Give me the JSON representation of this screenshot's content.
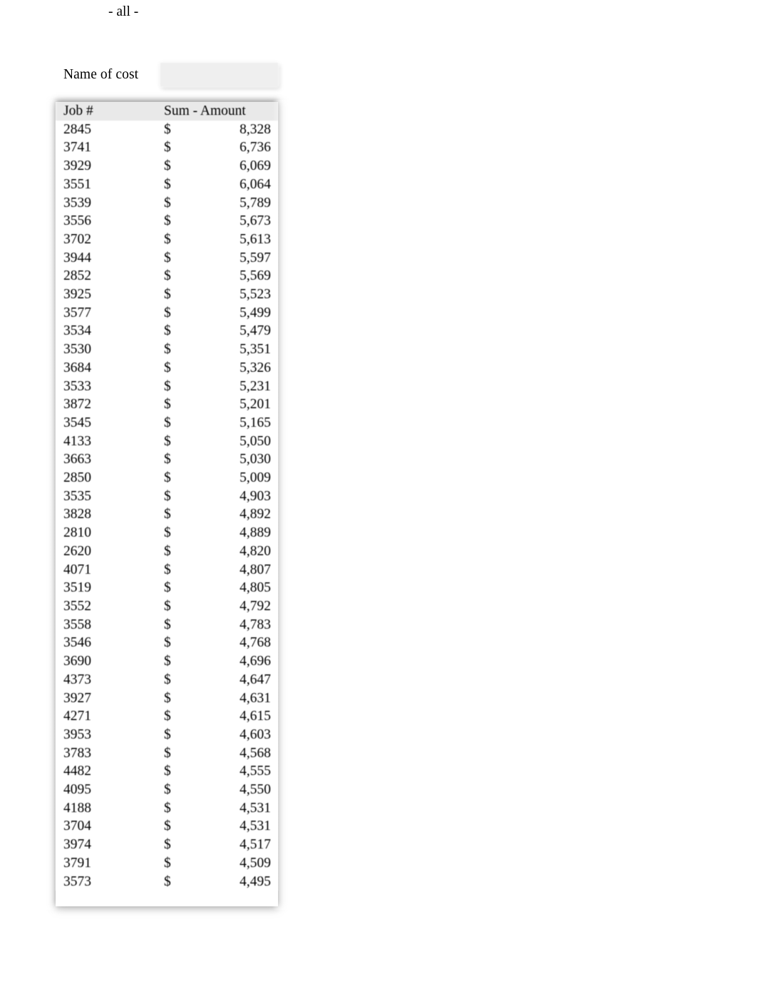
{
  "filter": {
    "label": "Name of cost",
    "value": "- all -"
  },
  "table": {
    "columns": [
      {
        "key": "job",
        "header": "Job #"
      },
      {
        "key": "amount",
        "header": "Sum -  Amount"
      }
    ],
    "currency_symbol": "$",
    "rows": [
      {
        "job": "2845",
        "amount": "8,328"
      },
      {
        "job": "3741",
        "amount": "6,736"
      },
      {
        "job": "3929",
        "amount": "6,069"
      },
      {
        "job": "3551",
        "amount": "6,064"
      },
      {
        "job": "3539",
        "amount": "5,789"
      },
      {
        "job": "3556",
        "amount": "5,673"
      },
      {
        "job": "3702",
        "amount": "5,613"
      },
      {
        "job": "3944",
        "amount": "5,597"
      },
      {
        "job": "2852",
        "amount": "5,569"
      },
      {
        "job": "3925",
        "amount": "5,523"
      },
      {
        "job": "3577",
        "amount": "5,499"
      },
      {
        "job": "3534",
        "amount": "5,479"
      },
      {
        "job": "3530",
        "amount": "5,351"
      },
      {
        "job": "3684",
        "amount": "5,326"
      },
      {
        "job": "3533",
        "amount": "5,231"
      },
      {
        "job": "3872",
        "amount": "5,201"
      },
      {
        "job": "3545",
        "amount": "5,165"
      },
      {
        "job": "4133",
        "amount": "5,050"
      },
      {
        "job": "3663",
        "amount": "5,030"
      },
      {
        "job": "2850",
        "amount": "5,009"
      },
      {
        "job": "3535",
        "amount": "4,903"
      },
      {
        "job": "3828",
        "amount": "4,892"
      },
      {
        "job": "2810",
        "amount": "4,889"
      },
      {
        "job": "2620",
        "amount": "4,820"
      },
      {
        "job": "4071",
        "amount": "4,807"
      },
      {
        "job": "3519",
        "amount": "4,805"
      },
      {
        "job": "3552",
        "amount": "4,792"
      },
      {
        "job": "3558",
        "amount": "4,783"
      },
      {
        "job": "3546",
        "amount": "4,768"
      },
      {
        "job": "3690",
        "amount": "4,696"
      },
      {
        "job": "4373",
        "amount": "4,647"
      },
      {
        "job": "3927",
        "amount": "4,631"
      },
      {
        "job": "4271",
        "amount": "4,615"
      },
      {
        "job": "3953",
        "amount": "4,603"
      },
      {
        "job": "3783",
        "amount": "4,568"
      },
      {
        "job": "4482",
        "amount": "4,555"
      },
      {
        "job": "4095",
        "amount": "4,550"
      },
      {
        "job": "4188",
        "amount": "4,531"
      },
      {
        "job": "3704",
        "amount": "4,531"
      },
      {
        "job": "3974",
        "amount": "4,517"
      },
      {
        "job": "3791",
        "amount": "4,509"
      },
      {
        "job": "3573",
        "amount": "4,495"
      }
    ]
  }
}
